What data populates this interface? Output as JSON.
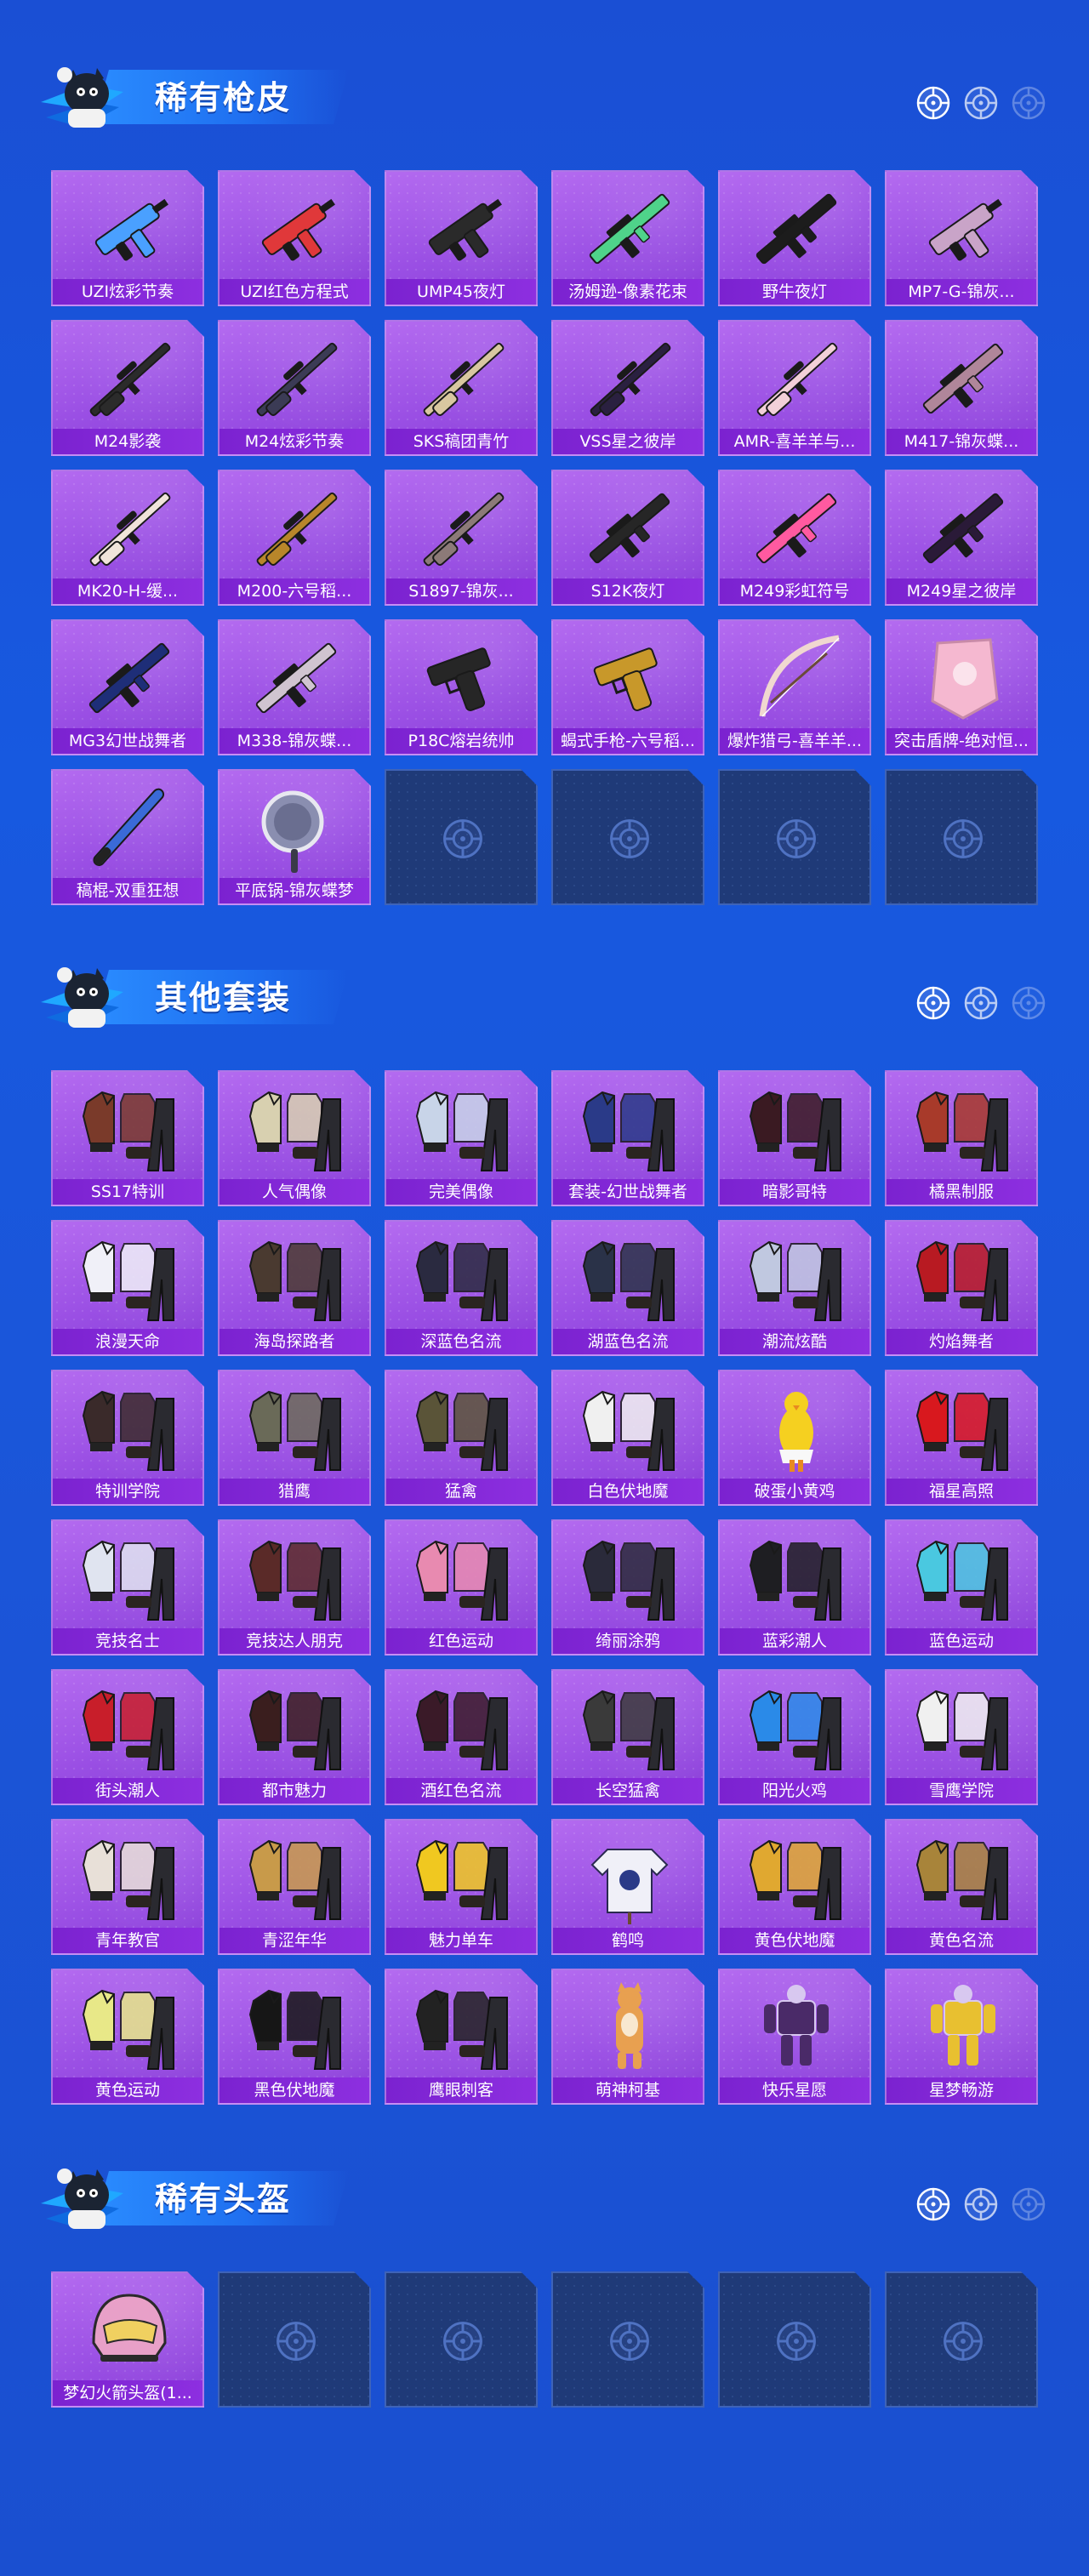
{
  "sections": [
    {
      "title": "稀有枪皮",
      "items": [
        {
          "label": "UZI炫彩节奏",
          "kind": "gun",
          "color": "#4aa0ff"
        },
        {
          "label": "UZI红色方程式",
          "kind": "gun",
          "color": "#e0383a"
        },
        {
          "label": "UMP45夜灯",
          "kind": "gun",
          "color": "#2a2a2a"
        },
        {
          "label": "汤姆逊-像素花束",
          "kind": "rifle",
          "color": "#4fd38a"
        },
        {
          "label": "野牛夜灯",
          "kind": "rifle",
          "color": "#1c1c1c"
        },
        {
          "label": "MP7-G-锦灰...",
          "kind": "gun",
          "color": "#c9a4c8"
        },
        {
          "label": "M24影袭",
          "kind": "sniper",
          "color": "#2b2b2b"
        },
        {
          "label": "M24炫彩节奏",
          "kind": "sniper",
          "color": "#3b3b55"
        },
        {
          "label": "SKS稿团青竹",
          "kind": "sniper",
          "color": "#d8c7a0"
        },
        {
          "label": "VSS星之彼岸",
          "kind": "sniper",
          "color": "#2a2040"
        },
        {
          "label": "AMR-喜羊羊与...",
          "kind": "sniper",
          "color": "#f2d0d8"
        },
        {
          "label": "M417-锦灰蝶...",
          "kind": "rifle",
          "color": "#b0869a"
        },
        {
          "label": "MK20-H-缓...",
          "kind": "sniper",
          "color": "#f0e4da"
        },
        {
          "label": "M200-六号稻...",
          "kind": "sniper",
          "color": "#b8862a"
        },
        {
          "label": "S1897-锦灰...",
          "kind": "sniper",
          "color": "#8c7a78"
        },
        {
          "label": "S12K夜灯",
          "kind": "rifle",
          "color": "#262626"
        },
        {
          "label": "M249彩虹符号",
          "kind": "rifle",
          "color": "#ff5aa0"
        },
        {
          "label": "M249星之彼岸",
          "kind": "rifle",
          "color": "#2a1a38"
        },
        {
          "label": "MG3幻世战舞者",
          "kind": "rifle",
          "color": "#1e2e78"
        },
        {
          "label": "M338-锦灰蝶...",
          "kind": "rifle",
          "color": "#d0c4d0"
        },
        {
          "label": "P18C熔岩统帅",
          "kind": "pistol",
          "color": "#262626"
        },
        {
          "label": "蝎式手枪-六号稻...",
          "kind": "pistol",
          "color": "#c8982a"
        },
        {
          "label": "爆炸猎弓-喜羊羊...",
          "kind": "bow",
          "color": "#f0d8d0"
        },
        {
          "label": "突击盾牌-绝对恒...",
          "kind": "shield",
          "color": "#f5b8d0"
        },
        {
          "label": "稿棍-双重狂想",
          "kind": "bat",
          "color": "#3a6ad8"
        },
        {
          "label": "平底锅-锦灰蝶梦",
          "kind": "pan",
          "color": "#8a8eb0"
        },
        {
          "label": "",
          "kind": "empty"
        },
        {
          "label": "",
          "kind": "empty"
        },
        {
          "label": "",
          "kind": "empty"
        },
        {
          "label": "",
          "kind": "empty"
        }
      ]
    },
    {
      "title": "其他套装",
      "items": [
        {
          "label": "SS17特训",
          "kind": "outfit",
          "color": "#7a3a2a"
        },
        {
          "label": "人气偶像",
          "kind": "outfit",
          "color": "#d8d0b0"
        },
        {
          "label": "完美偶像",
          "kind": "outfit",
          "color": "#c8d4e8"
        },
        {
          "label": "套装-幻世战舞者",
          "kind": "outfit",
          "color": "#2a3a88"
        },
        {
          "label": "暗影哥特",
          "kind": "outfit",
          "color": "#3a1a22"
        },
        {
          "label": "橘黑制服",
          "kind": "outfit",
          "color": "#a83a2a"
        },
        {
          "label": "浪漫天命",
          "kind": "outfit",
          "color": "#f0f0f8"
        },
        {
          "label": "海岛探路者",
          "kind": "outfit",
          "color": "#4a3a30"
        },
        {
          "label": "深蓝色名流",
          "kind": "outfit",
          "color": "#2a2a40"
        },
        {
          "label": "湖蓝色名流",
          "kind": "outfit",
          "color": "#2a3248"
        },
        {
          "label": "潮流炫酷",
          "kind": "outfit",
          "color": "#c0c8e0"
        },
        {
          "label": "灼焰舞者",
          "kind": "outfit",
          "color": "#b81a22"
        },
        {
          "label": "特训学院",
          "kind": "outfit",
          "color": "#3a2a2a"
        },
        {
          "label": "猎鹰",
          "kind": "outfit",
          "color": "#6a6a58"
        },
        {
          "label": "猛禽",
          "kind": "outfit",
          "color": "#5a5438"
        },
        {
          "label": "白色伏地魔",
          "kind": "outfit",
          "color": "#f0f0f0"
        },
        {
          "label": "破蛋小黄鸡",
          "kind": "chick",
          "color": "#f5d020"
        },
        {
          "label": "福星高照",
          "kind": "outfit",
          "color": "#d8181e"
        },
        {
          "label": "竞技名士",
          "kind": "outfit",
          "color": "#e0e4f0"
        },
        {
          "label": "竞技达人朋克",
          "kind": "outfit",
          "color": "#5a2a28"
        },
        {
          "label": "红色运动",
          "kind": "outfit",
          "color": "#e88ab0"
        },
        {
          "label": "绮丽涂鸦",
          "kind": "outfit",
          "color": "#2a2a3a"
        },
        {
          "label": "蓝彩潮人",
          "kind": "outfit",
          "color": "#1e1e22"
        },
        {
          "label": "蓝色运动",
          "kind": "outfit",
          "color": "#4ac8e0"
        },
        {
          "label": "街头潮人",
          "kind": "outfit",
          "color": "#c81e2a"
        },
        {
          "label": "都市魅力",
          "kind": "outfit",
          "color": "#3a1e1e"
        },
        {
          "label": "酒红色名流",
          "kind": "outfit",
          "color": "#3a1a28"
        },
        {
          "label": "长空猛禽",
          "kind": "outfit",
          "color": "#3a3a3a"
        },
        {
          "label": "阳光火鸡",
          "kind": "outfit",
          "color": "#2a8ae8"
        },
        {
          "label": "雪鹰学院",
          "kind": "outfit",
          "color": "#f0f0f0"
        },
        {
          "label": "青年教官",
          "kind": "outfit",
          "color": "#e8e0d8"
        },
        {
          "label": "青涩年华",
          "kind": "outfit",
          "color": "#c89a4a"
        },
        {
          "label": "魅力单车",
          "kind": "outfit",
          "color": "#f0c820"
        },
        {
          "label": "鹤鸣",
          "kind": "hoodie",
          "color": "#f0f0f8"
        },
        {
          "label": "黄色伏地魔",
          "kind": "outfit",
          "color": "#e0a830"
        },
        {
          "label": "黄色名流",
          "kind": "outfit",
          "color": "#a8843a"
        },
        {
          "label": "黄色运动",
          "kind": "outfit",
          "color": "#e8e888"
        },
        {
          "label": "黑色伏地魔",
          "kind": "outfit",
          "color": "#161616"
        },
        {
          "label": "鹰眼刺客",
          "kind": "outfit",
          "color": "#222222"
        },
        {
          "label": "萌神柯基",
          "kind": "corgi",
          "color": "#e8a050"
        },
        {
          "label": "快乐星愿",
          "kind": "mech",
          "color": "#4a2a68"
        },
        {
          "label": "星梦畅游",
          "kind": "mech",
          "color": "#e8c030"
        }
      ]
    },
    {
      "title": "稀有头盔",
      "items": [
        {
          "label": "梦幻火箭头盔(1...",
          "kind": "helmet",
          "color": "#e8a0c8"
        },
        {
          "label": "",
          "kind": "empty"
        },
        {
          "label": "",
          "kind": "empty"
        },
        {
          "label": "",
          "kind": "empty"
        },
        {
          "label": "",
          "kind": "empty"
        },
        {
          "label": "",
          "kind": "empty"
        }
      ]
    }
  ]
}
